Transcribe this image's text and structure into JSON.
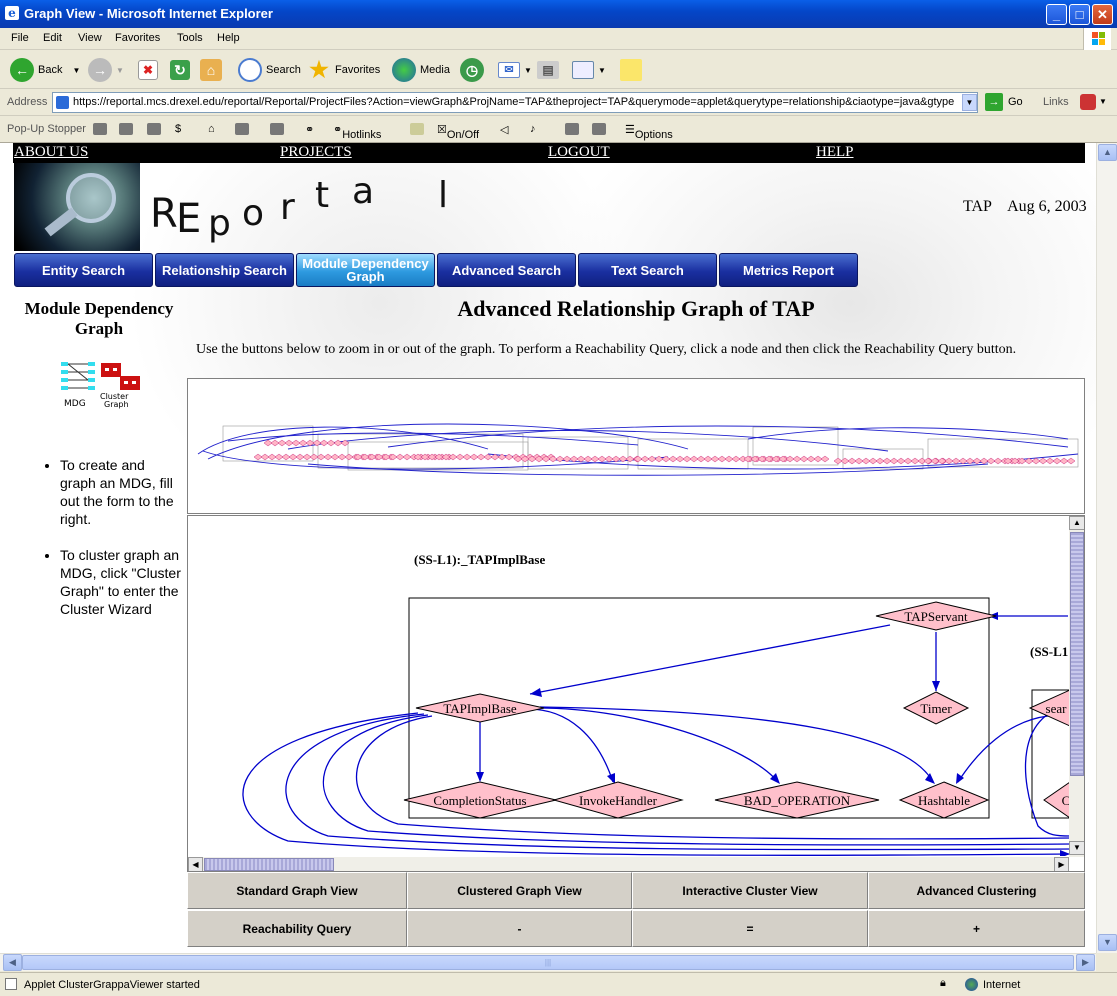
{
  "window": {
    "title": "Graph View - Microsoft Internet Explorer"
  },
  "menu": [
    "File",
    "Edit",
    "View",
    "Favorites",
    "Tools",
    "Help"
  ],
  "toolbar": {
    "back": "Back",
    "search": "Search",
    "favorites": "Favorites",
    "media": "Media"
  },
  "address": {
    "label": "Address",
    "url": "https://reportal.mcs.drexel.edu/reportal/Reportal/ProjectFiles?Action=viewGraph&ProjName=TAP&theproject=TAP&querymode=applet&querytype=relationship&ciaotype=java&gtype",
    "go": "Go",
    "links": "Links"
  },
  "popup_bar": {
    "label": "Pop-Up Stopper",
    "hotlinks": "Hotlinks",
    "onoff": "On/Off",
    "options": "Options"
  },
  "site_nav": [
    "ABOUT US",
    "PROJECTS",
    "LOGOUT",
    "HELP"
  ],
  "logo_text": "REportal",
  "project": "TAP",
  "date": "Aug 6, 2003",
  "tabs": [
    "Entity Search",
    "Relationship Search",
    "Module Dependency Graph",
    "Advanced Search",
    "Text Search",
    "Metrics Report"
  ],
  "left": {
    "title": "Module Dependency Graph",
    "icon_mdg": "MDG",
    "icon_cluster": "Cluster Graph",
    "bullets": [
      "To create and graph an MDG, fill out the form to the right.",
      "To cluster graph an MDG, click \"Cluster Graph\" to enter the Cluster Wizard"
    ]
  },
  "main": {
    "title": "Advanced Relationship Graph of TAP",
    "instructions": "Use the buttons below to zoom in or out of the graph. To perform a Reachability Query, click a node and then click the Reachability Query button."
  },
  "graph": {
    "cluster_label": "(SS-L1):_TAPImplBase",
    "cluster_label_2": "(SS-L1",
    "nodes": [
      "TAPServant",
      "Timer",
      "TAPImplBase",
      "CompletionStatus",
      "InvokeHandler",
      "BAD_OPERATION",
      "Hashtable",
      "sear",
      "C"
    ]
  },
  "buttons": [
    [
      "Standard Graph View",
      "Clustered Graph View",
      "Interactive Cluster View",
      "Advanced Clustering"
    ],
    [
      "Reachability Query",
      "-",
      "=",
      "+"
    ]
  ],
  "status": {
    "text": "Applet ClusterGrappaViewer started",
    "zone": "Internet"
  },
  "colors": {
    "tab": "#1a2fa0",
    "tab_active": "#2e9ae0",
    "node_fill": "#ffc0cb",
    "edge": "#0000cc"
  }
}
